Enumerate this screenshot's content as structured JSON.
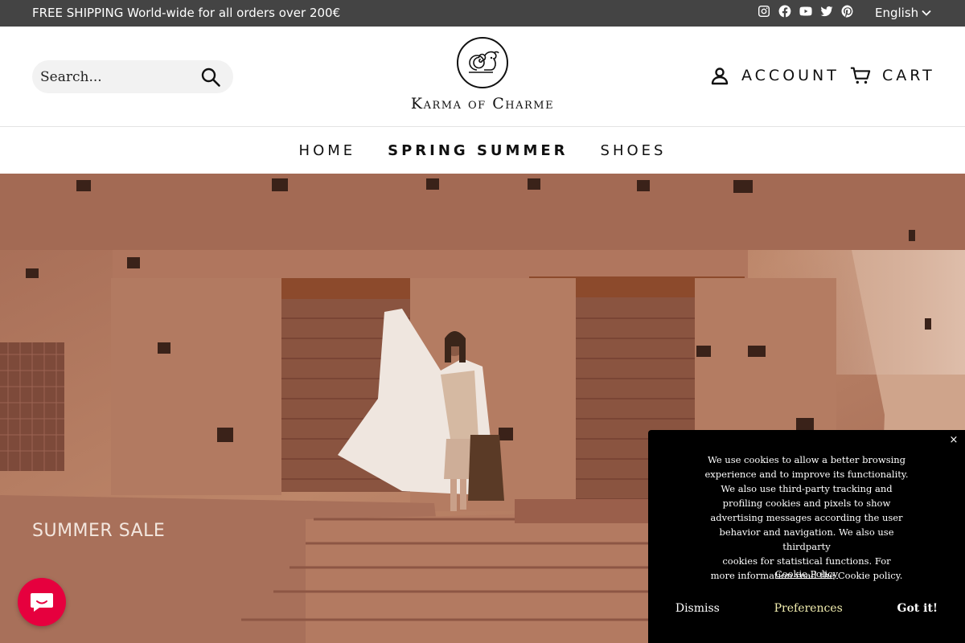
{
  "announcement": {
    "message": "FREE SHIPPING World-wide for all orders over 200€"
  },
  "socials": {
    "icons": [
      "instagram-icon",
      "facebook-icon",
      "youtube-icon",
      "twitter-icon",
      "pinterest-icon"
    ]
  },
  "language": {
    "selected": "English"
  },
  "header": {
    "search_placeholder": "Search...",
    "logo_text": "Karma of Charme",
    "account_label": "ACCOUNT",
    "cart_label": "CART"
  },
  "nav": {
    "items": [
      "HOME",
      "SPRING SUMMER",
      "SHOES"
    ],
    "active": "SPRING SUMMER"
  },
  "hero": {
    "caption": "SUMMER SALE"
  },
  "cookie": {
    "lines": [
      "We use cookies to allow a better browsing",
      "experience and to improve its functionality.",
      "We also use third-party tracking and",
      "profiling cookies and pixels to show",
      "advertising messages according the user",
      "behavior and navigation. We also use thirdparty",
      "cookies for statistical functions. For",
      "more information read the Cookie policy."
    ],
    "policy_link": "Cookie Policy",
    "dismiss": "Dismiss",
    "preferences": "Preferences",
    "accept": "Got it!",
    "close": "×"
  },
  "colors": {
    "topbar": "#444444",
    "chat_button": "#e6003e",
    "cookie_bg": "#000000"
  }
}
